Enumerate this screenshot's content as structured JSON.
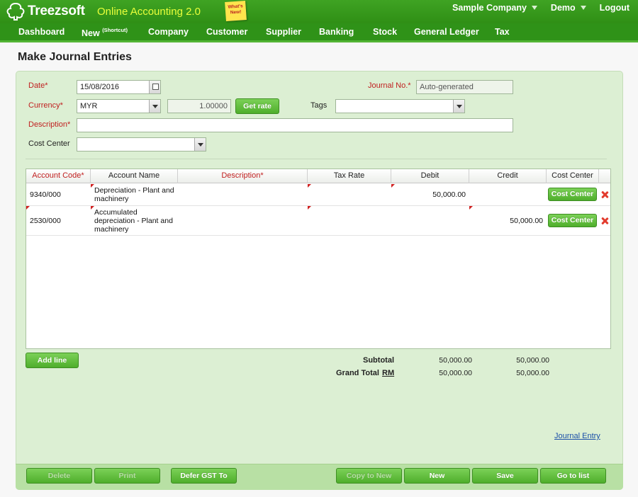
{
  "header": {
    "logo_text": "Treezsoft",
    "tagline": "Online Accounting 2.0",
    "whats_new": "What's New!",
    "company": "Sample Company",
    "user": "Demo",
    "logout": "Logout"
  },
  "nav": {
    "dashboard": "Dashboard",
    "new": "New",
    "new_sup": "(Shortcut)",
    "company": "Company",
    "customer": "Customer",
    "supplier": "Supplier",
    "banking": "Banking",
    "stock": "Stock",
    "general_ledger": "General Ledger",
    "tax": "Tax"
  },
  "page": {
    "title": "Make Journal Entries"
  },
  "form": {
    "date_label": "Date*",
    "date_value": "15/08/2016",
    "journal_no_label": "Journal No.*",
    "journal_no_value": "Auto-generated",
    "currency_label": "Currency*",
    "currency_value": "MYR",
    "rate_value": "1.00000",
    "get_rate": "Get rate",
    "tags_label": "Tags",
    "tags_value": "",
    "description_label": "Description*",
    "description_value": "",
    "cost_center_label": "Cost Center",
    "cost_center_value": ""
  },
  "grid": {
    "columns": [
      "Account Code*",
      "Account Name",
      "Description*",
      "Tax Rate",
      "Debit",
      "Credit",
      "Cost Center"
    ],
    "rows": [
      {
        "account_code": "9340/000",
        "account_name_lines": [
          "Depreciation - Plant and",
          "machinery"
        ],
        "description": "",
        "tax_rate": "",
        "debit": "50,000.00",
        "credit": "",
        "cost_center_btn": "Cost Center"
      },
      {
        "account_code": "2530/000",
        "account_name_lines": [
          "Accumulated",
          "depreciation - Plant and",
          "machinery"
        ],
        "description": "",
        "tax_rate": "",
        "debit": "",
        "credit": "50,000.00",
        "cost_center_btn": "Cost Center"
      }
    ]
  },
  "actions": {
    "add_line": "Add line"
  },
  "totals": {
    "subtotal_label": "Subtotal",
    "grand_total_label": "Grand Total",
    "currency_link": "RM",
    "subtotal_debit": "50,000.00",
    "subtotal_credit": "50,000.00",
    "grand_debit": "50,000.00",
    "grand_credit": "50,000.00"
  },
  "links": {
    "journal_entry": "Journal Entry"
  },
  "footer": {
    "delete": "Delete",
    "print": "Print",
    "defer_gst": "Defer GST To",
    "copy_to_new": "Copy to New",
    "new": "New",
    "save": "Save",
    "go_to_list": "Go to list"
  }
}
